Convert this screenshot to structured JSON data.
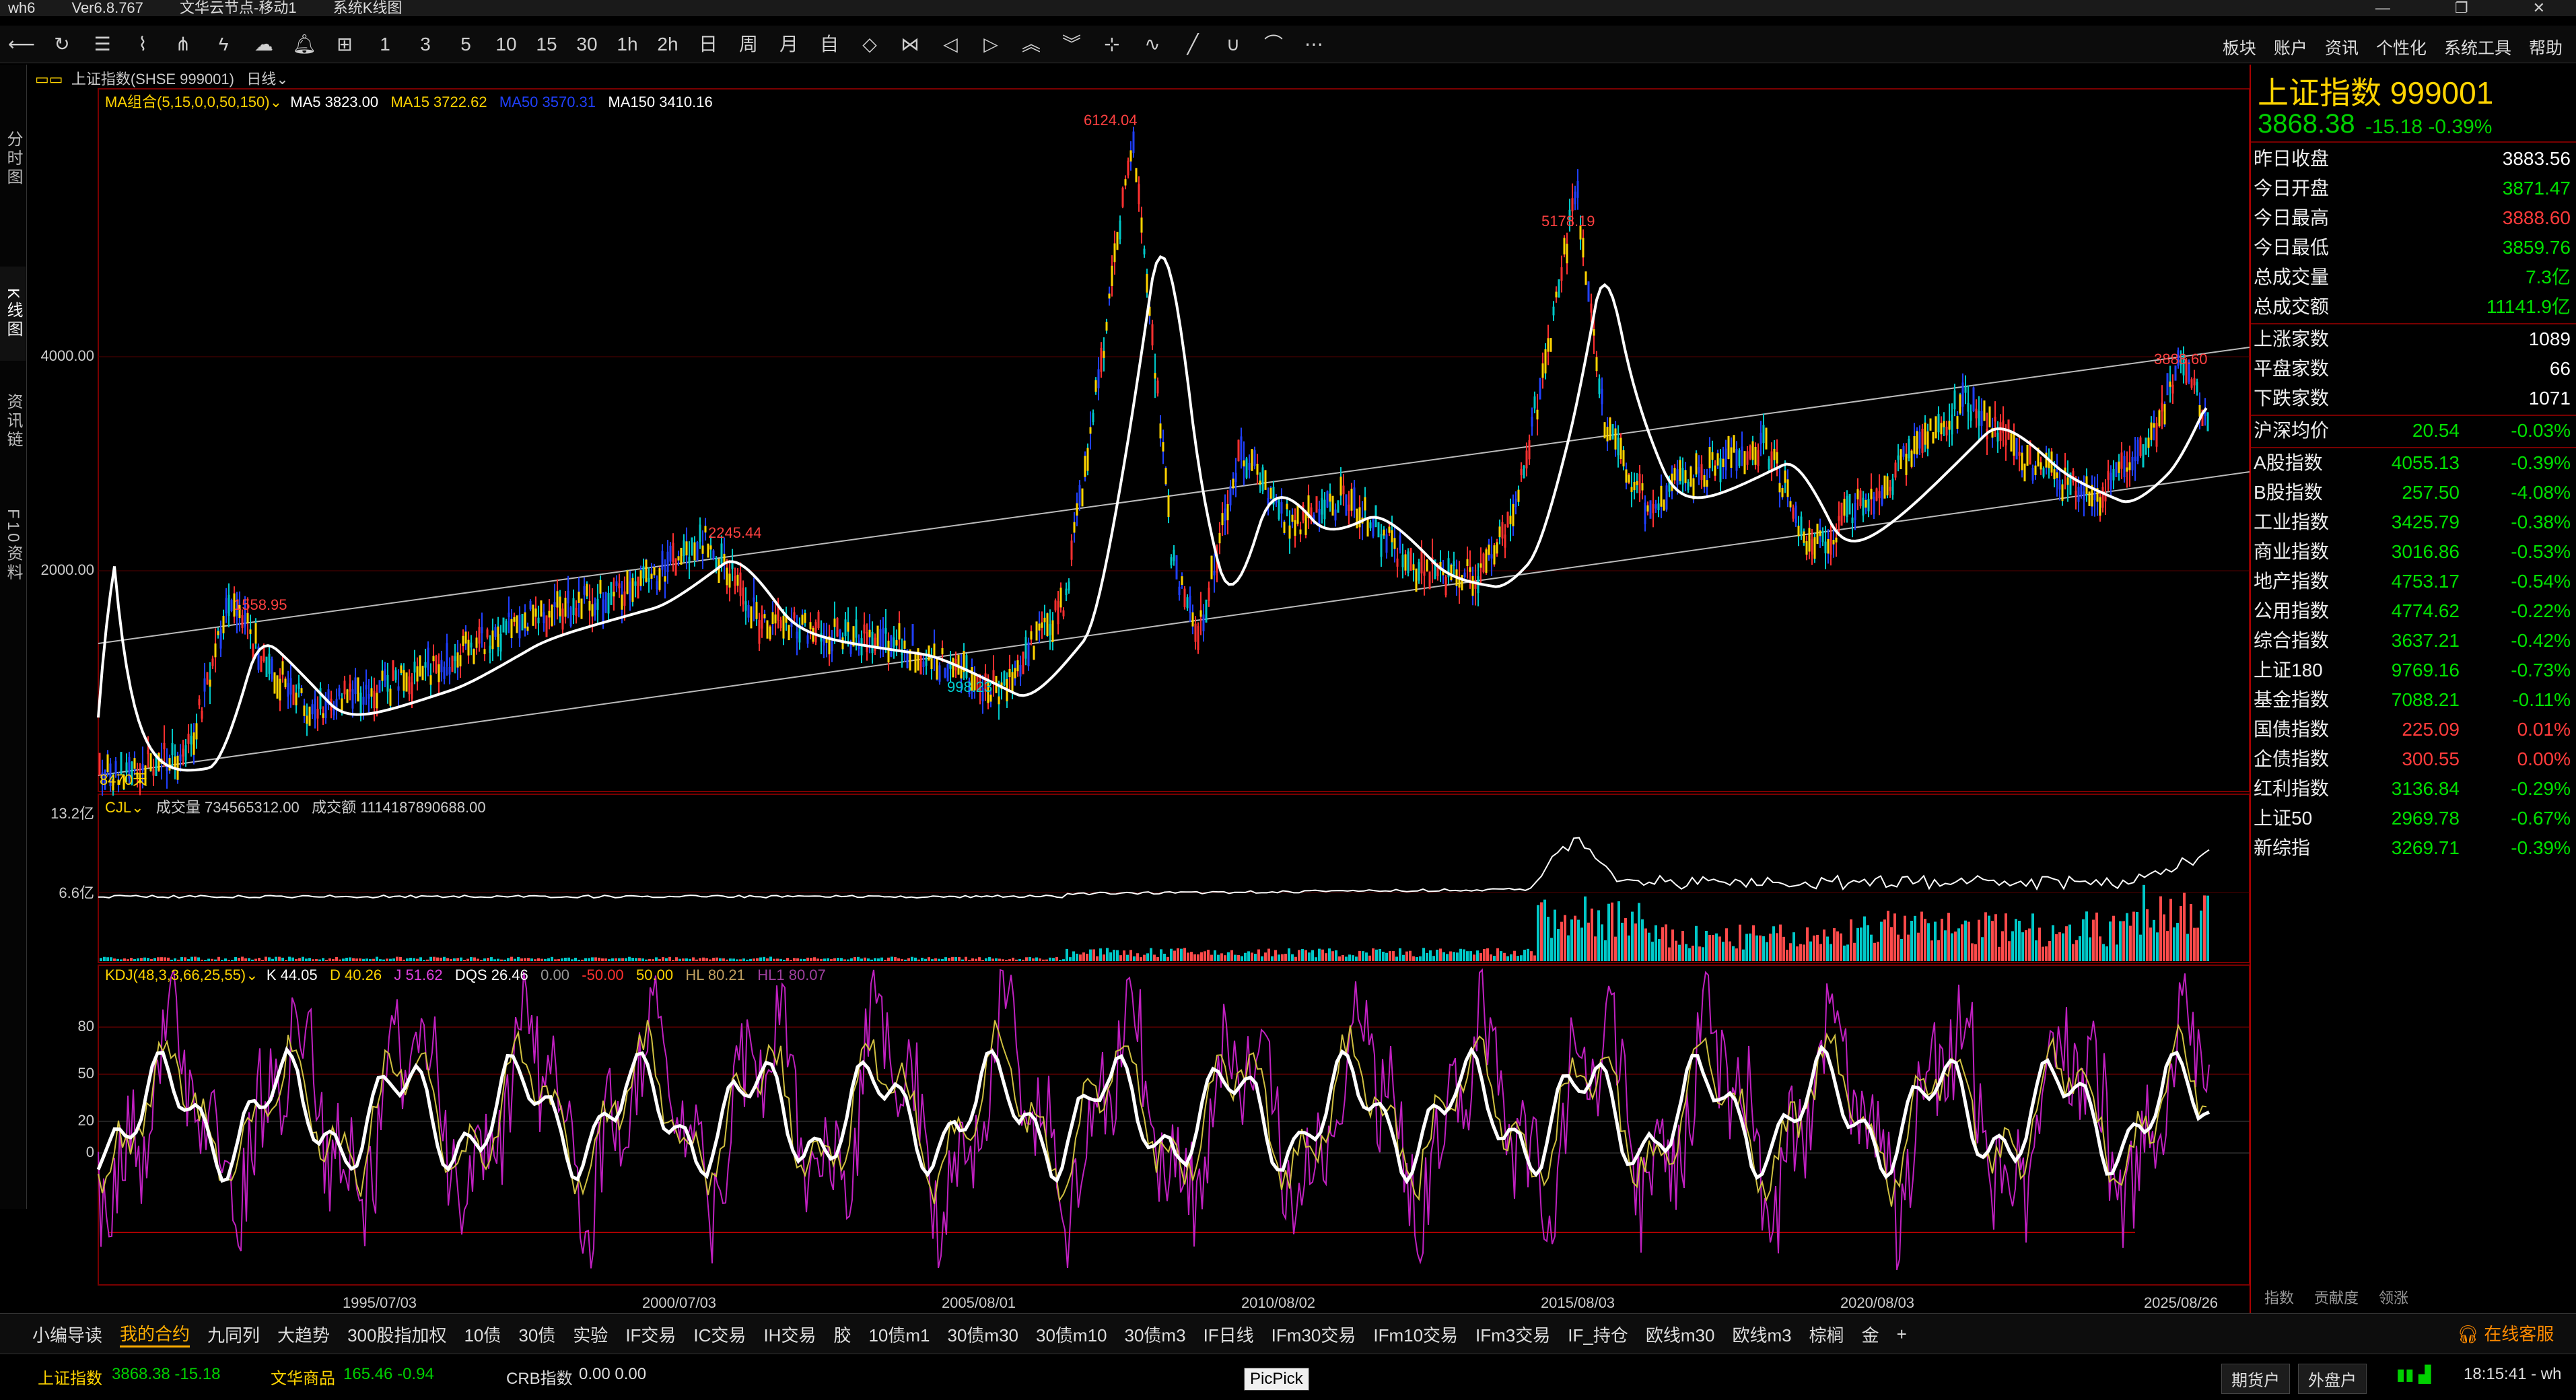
{
  "window": {
    "app_name": "wh6",
    "version": "Ver6.8.767",
    "server": "文华云节点-移动1",
    "page": "系统K线图"
  },
  "toolbar": {
    "icons": [
      "back-icon",
      "refresh-icon",
      "list-icon",
      "line-chart-icon",
      "split-icon",
      "lightning-icon",
      "cloud-icon",
      "bell-icon",
      "kline-icon",
      "1",
      "3",
      "5",
      "10",
      "15",
      "30",
      "1h",
      "2h",
      "日",
      "周",
      "月",
      "自",
      "diamond-icon",
      "bowtie-icon",
      "left-icon",
      "right-icon",
      "up-icon",
      "down-icon",
      "crosshair-icon",
      "draw-line-icon",
      "slash-icon",
      "u-icon",
      "arc-icon",
      "more-icon"
    ],
    "menu": [
      "板块",
      "账户",
      "资讯",
      "个性化",
      "系统工具",
      "帮助"
    ]
  },
  "left_tabs": [
    "分时图",
    "K线图",
    "资讯链",
    "F10资料"
  ],
  "chart_header": {
    "symbol_label": "上证指数(SHSE 999001)",
    "period": "日线",
    "ma_group": "MA组合(5,15,0,0,50,150)",
    "ma5": "MA5  3823.00",
    "ma15": "MA15  3722.62",
    "ma50": "MA50  3570.31",
    "ma150": "MA150  3410.16",
    "day_count": "8470天"
  },
  "annotations": {
    "p1": "1558.95",
    "p2": "2245.44",
    "p3": "998.23",
    "p4": "6124.04",
    "p5": "5178.19",
    "p6": "3888.60"
  },
  "axes": {
    "price_ticks": [
      "4000.00",
      "2000.00"
    ],
    "vol_ticks": [
      "13.2亿",
      "6.6亿"
    ],
    "kdj_ticks": [
      "80",
      "50",
      "20",
      "0"
    ],
    "dates": [
      "1995/07/03",
      "2000/07/03",
      "2005/08/01",
      "2010/08/02",
      "2015/08/03",
      "2020/08/03",
      "2025/08/26"
    ]
  },
  "volume_header": {
    "name": "CJL",
    "vol": "成交量  734565312.00",
    "amount": "成交额  1114187890688.00"
  },
  "kdj_header": {
    "name": "KDJ(48,3,3,66,25,55)",
    "k": "K  44.05",
    "d": "D  40.26",
    "j": "J  51.62",
    "dqs": "DQS  26.46",
    "v1": "0.00",
    "v2": "-50.00",
    "v3": "50.00",
    "hl": "HL  80.21",
    "hl1": "HL1  80.07"
  },
  "quote": {
    "title": "上证指数  999001",
    "price": "3868.38",
    "change": "-15.18   -0.39%",
    "stats": [
      {
        "label": "昨日收盘",
        "value": "3883.56",
        "color": "#ffffff"
      },
      {
        "label": "今日开盘",
        "value": "3871.47",
        "color": "#00e000"
      },
      {
        "label": "今日最高",
        "value": "3888.60",
        "color": "#ff3b3b"
      },
      {
        "label": "今日最低",
        "value": "3859.76",
        "color": "#00e000"
      },
      {
        "label": "总成交量",
        "value": "7.3亿",
        "color": "#00e000"
      },
      {
        "label": "总成交额",
        "value": "11141.9亿",
        "color": "#00e000"
      }
    ],
    "breadth": [
      {
        "label": "上涨家数",
        "value": "1089",
        "color": "#ffffff"
      },
      {
        "label": "平盘家数",
        "value": "66",
        "color": "#ffffff"
      },
      {
        "label": "下跌家数",
        "value": "1071",
        "color": "#ffffff"
      }
    ],
    "avg": {
      "label": "沪深均价",
      "v1": "20.54",
      "v2": "-0.03%"
    },
    "indices": [
      {
        "label": "A股指数",
        "v1": "4055.13",
        "v2": "-0.39%",
        "c": "#00e000"
      },
      {
        "label": "B股指数",
        "v1": "257.50",
        "v2": "-4.08%",
        "c": "#00e000"
      },
      {
        "label": "工业指数",
        "v1": "3425.79",
        "v2": "-0.38%",
        "c": "#00e000"
      },
      {
        "label": "商业指数",
        "v1": "3016.86",
        "v2": "-0.53%",
        "c": "#00e000"
      },
      {
        "label": "地产指数",
        "v1": "4753.17",
        "v2": "-0.54%",
        "c": "#00e000"
      },
      {
        "label": "公用指数",
        "v1": "4774.62",
        "v2": "-0.22%",
        "c": "#00e000"
      },
      {
        "label": "综合指数",
        "v1": "3637.21",
        "v2": "-0.42%",
        "c": "#00e000"
      },
      {
        "label": "上证180",
        "v1": "9769.16",
        "v2": "-0.73%",
        "c": "#00e000"
      },
      {
        "label": "基金指数",
        "v1": "7088.21",
        "v2": "-0.11%",
        "c": "#00e000"
      },
      {
        "label": "国债指数",
        "v1": "225.09",
        "v2": "0.01%",
        "c": "#ff3b3b"
      },
      {
        "label": "企债指数",
        "v1": "300.55",
        "v2": "0.00%",
        "c": "#ff3b3b"
      },
      {
        "label": "红利指数",
        "v1": "3136.84",
        "v2": "-0.29%",
        "c": "#00e000"
      },
      {
        "label": "上证50",
        "v1": "2969.78",
        "v2": "-0.67%",
        "c": "#00e000"
      },
      {
        "label": "新综指",
        "v1": "3269.71",
        "v2": "-0.39%",
        "c": "#00e000"
      }
    ],
    "bottom_tabs": [
      "指数",
      "贡献度",
      "领涨"
    ]
  },
  "contract_tabs": [
    "小编导读",
    "我的合约",
    "九同列",
    "大趋势",
    "300股指加权",
    "10债",
    "30债",
    "实验",
    "IF交易",
    "IC交易",
    "IH交易",
    "胶",
    "10债m1",
    "30债m30",
    "30债m10",
    "30债m3",
    "IF日线",
    "IFm30交易",
    "IFm10交易",
    "IFm3交易",
    "IF_持仓",
    "欧线m30",
    "欧线m3",
    "棕榈",
    "金",
    "+"
  ],
  "status": {
    "idx1_name": "上证指数",
    "idx1_vals": "3868.38  -15.18",
    "idx2_name": "文华商品",
    "idx2_vals": "165.46  -0.94",
    "idx3_name": "CRB指数",
    "idx3_vals": "0.00  0.00",
    "picpick": "PicPick",
    "btn1": "期货户",
    "btn2": "外盘户",
    "online": "在线客服",
    "time": "18:15:41 - wh"
  }
}
